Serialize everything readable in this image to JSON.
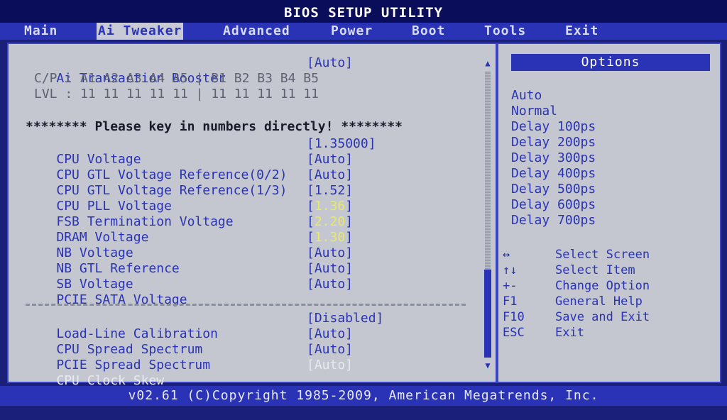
{
  "title": "BIOS SETUP UTILITY",
  "menu": {
    "items": [
      {
        "label": "Main"
      },
      {
        "label": "Ai Tweaker"
      },
      {
        "label": "Advanced"
      },
      {
        "label": "Power"
      },
      {
        "label": "Boot"
      },
      {
        "label": "Tools"
      },
      {
        "label": "Exit"
      }
    ],
    "active": "Ai Tweaker"
  },
  "main": {
    "transaction_booster": {
      "label": "Ai Transaction Booster",
      "value": "[Auto]"
    },
    "cp_line": "C/P : A1 A2 A3 A4 A5 | B1 B2 B3 B4 B5",
    "lvl_line": "LVL : 11 11 11 11 11 | 11 11 11 11 11",
    "notice": "******** Please key in numbers directly! ********",
    "voltages": [
      {
        "label": "CPU Voltage",
        "open": "[",
        "value": "1.35000",
        "close": "]"
      },
      {
        "label": "CPU GTL Voltage Reference(0/2)",
        "open": "[",
        "value": "Auto",
        "close": "]"
      },
      {
        "label": "CPU GTL Voltage Reference(1/3)",
        "open": "[",
        "value": "Auto",
        "close": "]"
      },
      {
        "label": "CPU PLL Voltage",
        "open": "[",
        "value": "1.52",
        "close": "]"
      },
      {
        "label": "FSB Termination Voltage",
        "open": "[",
        "value": "1.36",
        "close": "]"
      },
      {
        "label": "DRAM Voltage",
        "open": "[",
        "value": "2.20",
        "close": "]"
      },
      {
        "label": "NB Voltage",
        "open": "[",
        "value": "1.30",
        "close": "]"
      },
      {
        "label": "NB GTL Reference",
        "open": "[",
        "value": "Auto",
        "close": "]"
      },
      {
        "label": "SB Voltage",
        "open": "[",
        "value": "Auto",
        "close": "]"
      },
      {
        "label": "PCIE SATA Voltage",
        "open": "[",
        "value": "Auto",
        "close": "]"
      }
    ],
    "settings": [
      {
        "label": "Load-Line Calibration",
        "value": "[Disabled]"
      },
      {
        "label": "CPU Spread Spectrum",
        "value": "[Auto]"
      },
      {
        "label": "PCIE Spread Spectrum",
        "value": "[Auto]"
      },
      {
        "label": "CPU Clock Skew",
        "value": "[Auto]"
      }
    ]
  },
  "options": {
    "header": "Options",
    "items": [
      "Auto",
      "Normal",
      "Delay 100ps",
      "Delay 200ps",
      "Delay 300ps",
      "Delay 400ps",
      "Delay 500ps",
      "Delay 600ps",
      "Delay 700ps"
    ]
  },
  "help": [
    {
      "key": "↔",
      "desc": "Select Screen"
    },
    {
      "key": "↑↓",
      "desc": "Select Item"
    },
    {
      "key": "+-",
      "desc": "Change Option"
    },
    {
      "key": "F1",
      "desc": "General Help"
    },
    {
      "key": "F10",
      "desc": "Save and Exit"
    },
    {
      "key": "ESC",
      "desc": "Exit"
    }
  ],
  "footer": "v02.61 (C)Copyright 1985-2009, American Megatrends, Inc.",
  "colors": {
    "bg": "#1a1f7a",
    "accent": "#2a33b5",
    "panel": "#c4c7d0",
    "highlight": "#e8e86a"
  }
}
